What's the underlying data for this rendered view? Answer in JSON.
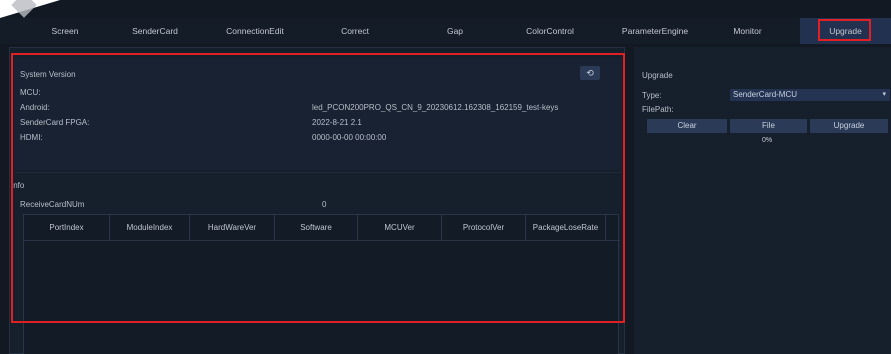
{
  "tabs": [
    "Screen",
    "SenderCard",
    "ConnectionEdit",
    "Correct",
    "Gap",
    "ColorControl",
    "ParameterEngine",
    "Monitor",
    "Upgrade"
  ],
  "active_tab": "Upgrade",
  "system_version": {
    "title": "System Version",
    "rows": [
      {
        "label": "MCU:",
        "value": ""
      },
      {
        "label": "Android:",
        "value": "led_PCON200PRO_QS_CN_9_20230612.162308_162159_test-keys"
      },
      {
        "label": "SenderCard FPGA:",
        "value": "2022-8-21 2.1"
      },
      {
        "label": "HDMI:",
        "value": "0000-00-00 00:00:00"
      }
    ],
    "refresh_glyph": "⟲"
  },
  "info": {
    "title": "Info",
    "receive_label": "ReceiveCardNUm",
    "receive_value": "0",
    "columns": [
      "PortIndex",
      "ModuleIndex",
      "HardWareVer",
      "Software",
      "MCUVer",
      "ProtocolVer",
      "PackageLoseRate"
    ]
  },
  "upgrade": {
    "title": "Upgrade",
    "type_label": "Type:",
    "type_value": "SenderCard-MCU",
    "caret": "▾",
    "filepath_label": "FilePath:",
    "buttons": {
      "clear": "Clear",
      "file": "File",
      "upgrade": "Upgrade"
    },
    "progress": "0%"
  },
  "colors": {
    "highlight": "#e02025",
    "active_tab": "#223150",
    "button": "#2a3a57"
  }
}
